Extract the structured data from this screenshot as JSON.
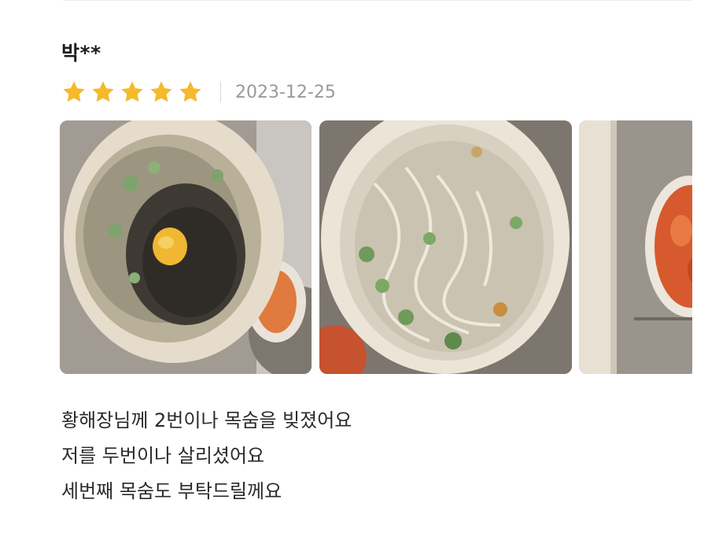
{
  "review": {
    "reviewer": "박**",
    "rating": 5,
    "rating_max": 5,
    "date": "2023-12-25",
    "star_color": "#f5b92b",
    "photos": [
      {
        "icon": "food-photo-rice-soup-with-egg"
      },
      {
        "icon": "food-photo-noodle-soup"
      },
      {
        "icon": "food-photo-kimchi"
      }
    ],
    "text_lines": [
      "황해장님께 2번이나 목숨을 빚졌어요",
      "저를 두번이나 살리셨어요",
      "세번째 목숨도 부탁드릴께요"
    ]
  }
}
